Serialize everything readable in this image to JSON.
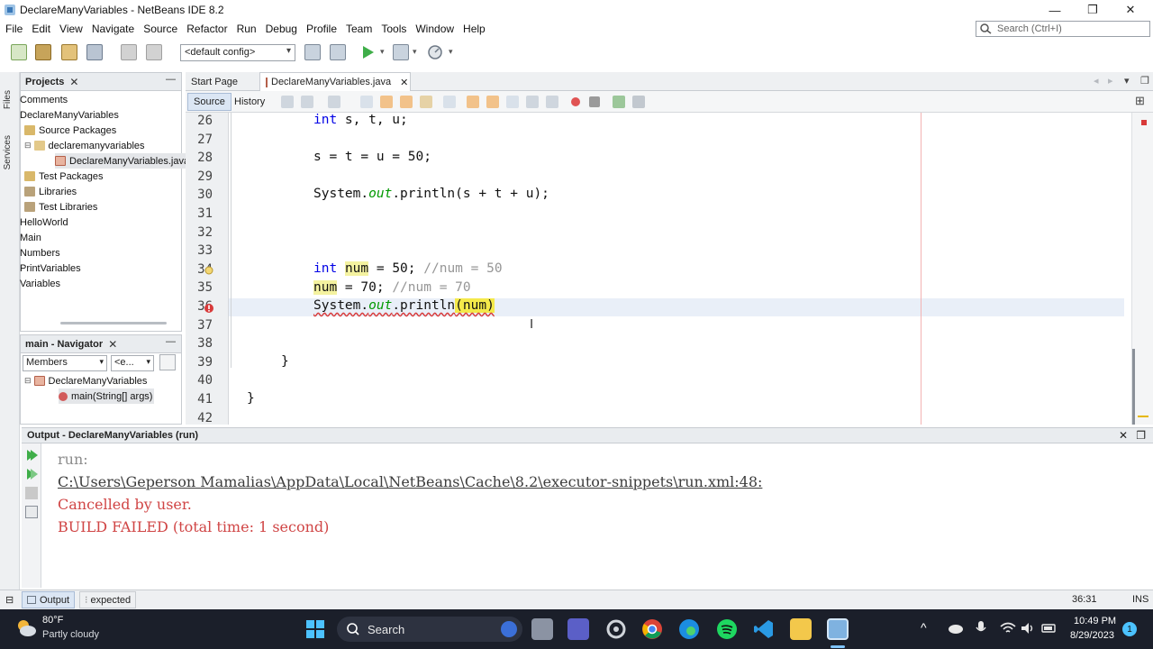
{
  "window": {
    "title": "DeclareManyVariables - NetBeans IDE 8.2",
    "controls": {
      "minimize": "—",
      "restore": "❐",
      "close": "✕"
    }
  },
  "menu": [
    "File",
    "Edit",
    "View",
    "Navigate",
    "Source",
    "Refactor",
    "Run",
    "Debug",
    "Profile",
    "Team",
    "Tools",
    "Window",
    "Help"
  ],
  "search": {
    "placeholder": "Search (Ctrl+I)"
  },
  "toolbar": {
    "config": "<default config>"
  },
  "side_strip": {
    "files": "Files",
    "services": "Services"
  },
  "projects": {
    "title": "Projects",
    "items": [
      {
        "label": "Comments",
        "indent": 0
      },
      {
        "label": "DeclareManyVariables",
        "indent": 0
      },
      {
        "label": "Source Packages",
        "indent": 1
      },
      {
        "label": "declaremanyvariables",
        "indent": 2
      },
      {
        "label": "DeclareManyVariables.java",
        "indent": 3
      },
      {
        "label": "Test Packages",
        "indent": 1
      },
      {
        "label": "Libraries",
        "indent": 1
      },
      {
        "label": "Test Libraries",
        "indent": 1
      },
      {
        "label": "HelloWorld",
        "indent": 0
      },
      {
        "label": "Main",
        "indent": 0
      },
      {
        "label": "Numbers",
        "indent": 0
      },
      {
        "label": "PrintVariables",
        "indent": 0
      },
      {
        "label": "Variables",
        "indent": 0
      }
    ]
  },
  "navigator": {
    "title": "main - Navigator",
    "filter": "Members",
    "filter2": "<e...",
    "class_node": "DeclareManyVariables",
    "method_node": "main(String[] args)"
  },
  "editor": {
    "tabs": [
      "Start Page",
      "DeclareManyVariables.java"
    ],
    "views": [
      "Source",
      "History"
    ],
    "line_numbers": [
      "26",
      "27",
      "28",
      "29",
      "30",
      "31",
      "32",
      "33",
      "34",
      "35",
      "36",
      "37",
      "38",
      "39",
      "40",
      "41",
      "42"
    ],
    "code": {
      "l26_kw": "int",
      "l26_rest": " s, t, u;",
      "l28": "s = t = u = 50;",
      "l30_a": "System.",
      "l30_out": "out",
      "l30_b": ".println(s + t + u);",
      "l34_kw": "int",
      "l34_var": "num",
      "l34_rest": " = 50; ",
      "l34_cm": "//num = 50",
      "l35_var": "num",
      "l35_rest": " = 70; ",
      "l35_cm": "//num = 70",
      "l36_a": "System.",
      "l36_out": "out",
      "l36_b": ".println",
      "l36_hl": "(num)",
      "l39": "}",
      "l41": "}"
    }
  },
  "output": {
    "title": "Output - DeclareManyVariables (run)",
    "lines": [
      "run:",
      "C:\\Users\\Geperson Mamalias\\AppData\\Local\\NetBeans\\Cache\\8.2\\executor-snippets\\run.xml:48:",
      "Cancelled by user.",
      "BUILD FAILED (total time: 1 second)"
    ],
    "colors": {
      "muted": "#8c8c8c",
      "error": "#d04545",
      "link": "#3c3c3c"
    }
  },
  "statusbar": {
    "output_tab": "Output",
    "expected": "expected",
    "position": "36:31",
    "mode": "INS"
  },
  "taskbar": {
    "weather_temp": "80°F",
    "weather_desc": "Partly cloudy",
    "search": "Search",
    "time": "10:49 PM",
    "date": "8/29/2023",
    "notifications": "1"
  }
}
